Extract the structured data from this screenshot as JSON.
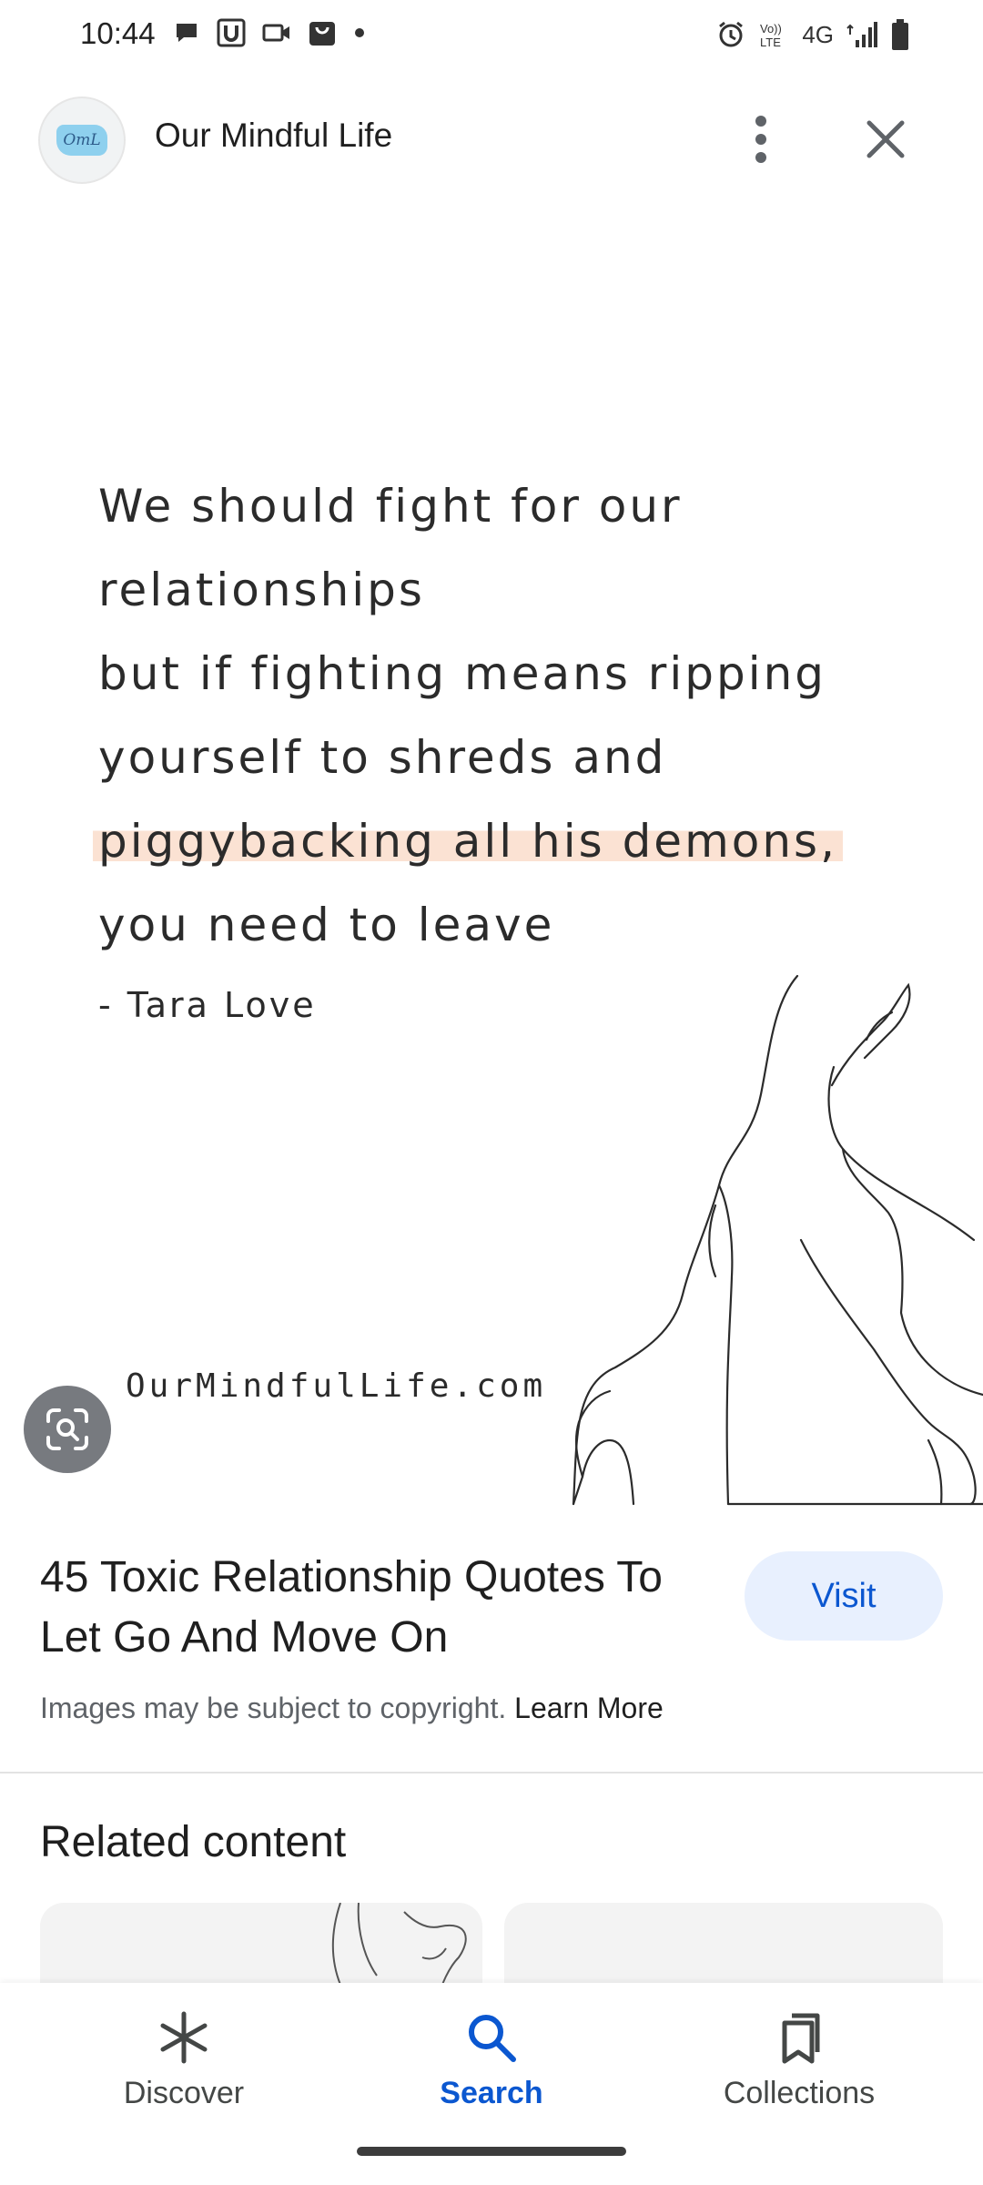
{
  "status_bar": {
    "time": "10:44",
    "network": "4G",
    "notification_icons": [
      "chat-bubble-icon",
      "u-app-icon",
      "video-icon",
      "shopping-bag-icon",
      "dot-icon"
    ],
    "system_icons": [
      "alarm-icon",
      "volte-icon",
      "signal-icon",
      "battery-icon"
    ]
  },
  "header": {
    "avatar_text": "OmL",
    "site_name": "Our Mindful Life"
  },
  "image": {
    "quote_lines": [
      "We should fight for our",
      "relationships",
      "but if fighting means ripping",
      "yourself to shreds and",
      "piggybacking all his demons,",
      "you need to leave"
    ],
    "author": "- Tara Love",
    "watermark": "OurMindfulLife.com"
  },
  "result": {
    "title": "45 Toxic Relationship Quotes To Let Go And Move On",
    "visit_label": "Visit",
    "copyright_text": "Images may be subject to copyright.",
    "learn_more": "Learn More"
  },
  "related": {
    "heading": "Related content"
  },
  "bottom_nav": {
    "items": [
      {
        "label": "Discover",
        "icon": "asterisk-icon",
        "active": false
      },
      {
        "label": "Search",
        "icon": "search-icon",
        "active": true
      },
      {
        "label": "Collections",
        "icon": "bookmarks-icon",
        "active": false
      }
    ]
  },
  "colors": {
    "accent": "#0b57d0",
    "visit_bg": "#e8f0fe",
    "highlight": "#fbe2d3"
  }
}
